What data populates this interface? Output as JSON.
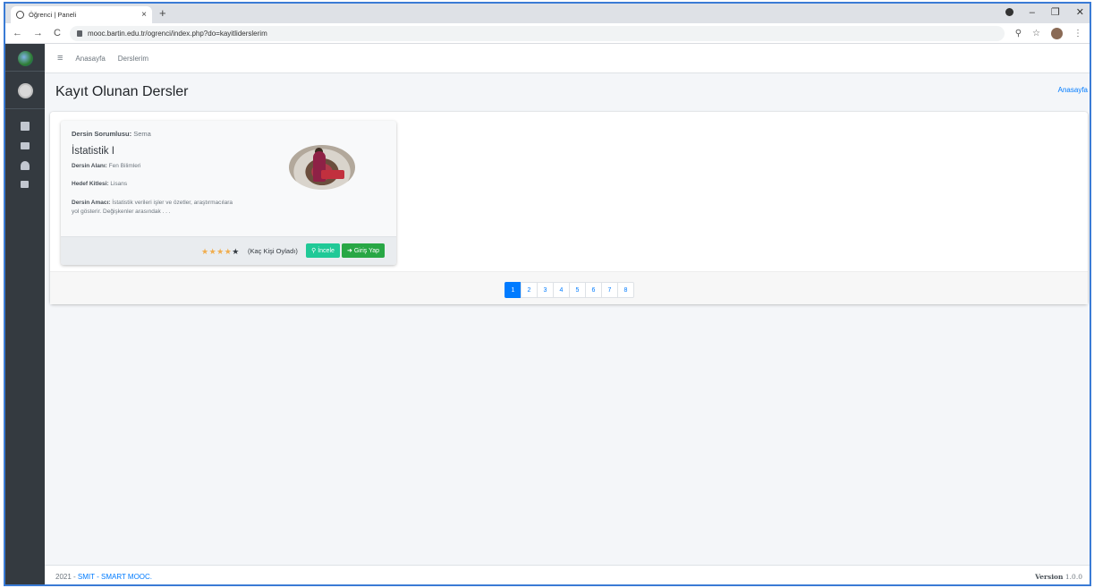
{
  "browser": {
    "tab_title": "Öğrenci | Paneli",
    "tab_close": "×",
    "new_tab": "+",
    "url": "mooc.bartin.edu.tr/ogrenci/index.php?do=kayitliderslerim",
    "back": "←",
    "forward": "→",
    "reload": "C",
    "zoom_icon": "⚲",
    "star_icon": "☆",
    "menu_icon": "⋮",
    "minimize": "–",
    "restore": "❐",
    "close": "✕"
  },
  "topnav": {
    "menu_icon": "≡",
    "home": "Anasayfa",
    "courses": "Derslerim"
  },
  "header": {
    "title": "Kayıt Olunan Dersler",
    "breadcrumb": "Anasayfa"
  },
  "course": {
    "responsible_label": "Dersin Sorumlusu:",
    "responsible": "Sema",
    "title": "İstatistik I",
    "field_label": "Dersin Alanı:",
    "field": "Fen Bilimleri",
    "audience_label": "Hedef Kitlesi:",
    "audience": "Lisans",
    "purpose_label": "Dersin Amacı:",
    "purpose": "İstatistik verileri işler ve özetler, araştırmacılara yol gösterir. Değişkenler arasındak . . .",
    "stars_on": "★★★★",
    "stars_off": "★",
    "rating": 4,
    "rating_max": 5,
    "votes": "(Kaç Kişi Oyladı)",
    "inspect_label": "İncele",
    "inspect_icon": "🔍",
    "enter_label": "Giriş Yap",
    "enter_icon": "➜"
  },
  "pagination": {
    "pages": [
      "1",
      "2",
      "3",
      "4",
      "5",
      "6",
      "7",
      "8"
    ],
    "active": "1"
  },
  "footer": {
    "year": "2021 - ",
    "brand": "SMIT - SMART MOOC.",
    "version_label": "Version",
    "version": "1.0.0"
  },
  "colors": {
    "sidebar": "#343a40",
    "primary": "#007bff",
    "teal": "#20c997",
    "success": "#28a745",
    "star": "#f0ad4e"
  }
}
